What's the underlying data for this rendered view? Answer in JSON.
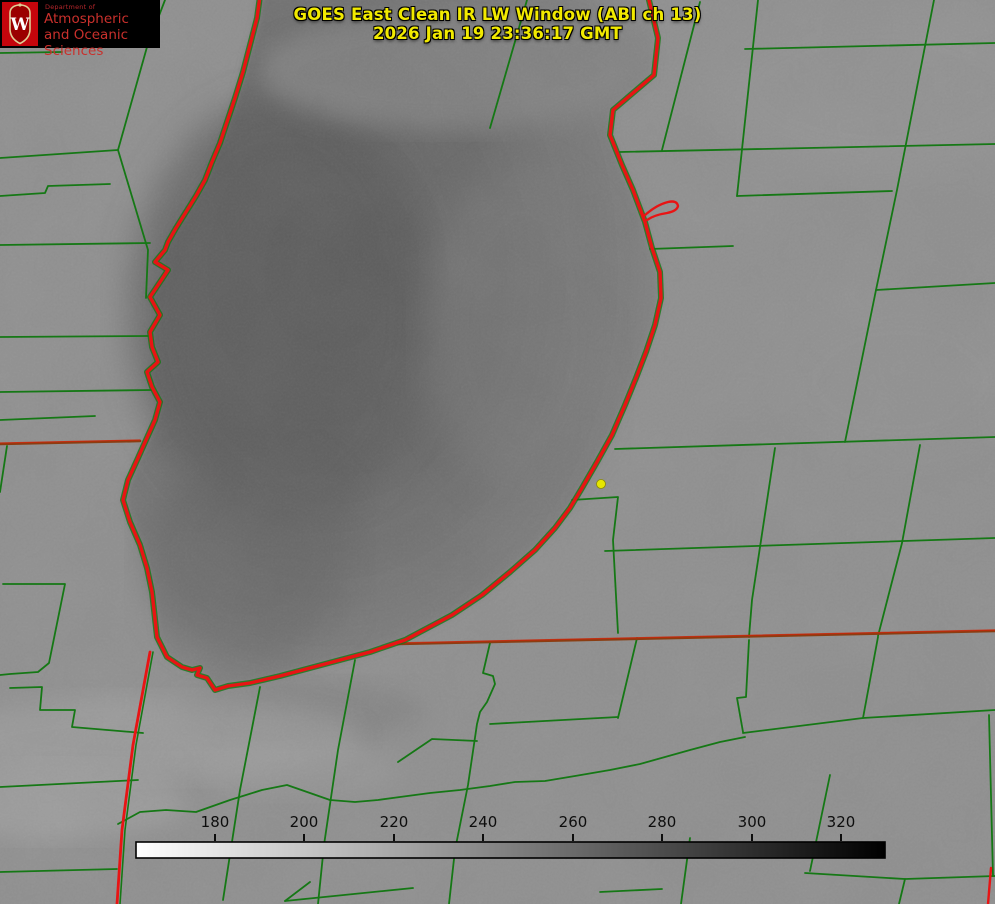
{
  "branding": {
    "department_prefix": "Department of",
    "department_line1": "Atmospheric",
    "department_line2": "and Oceanic Sciences",
    "crest_letter": "W",
    "panel_bg": "#000000",
    "crest_bg": "#c5050c"
  },
  "title": {
    "line1": "GOES East Clean IR LW Window (ABI ch 13)",
    "line2": "2026 Jan 19 23:36:17 GMT",
    "color": "#f2ea00"
  },
  "colorbar": {
    "tick_labels": [
      "180",
      "200",
      "220",
      "240",
      "260",
      "280",
      "300",
      "320"
    ],
    "left_color": "#ffffff",
    "right_color": "#000000"
  },
  "overlay": {
    "county_color": "#157815",
    "shoreline_color": "#e81414",
    "state_color": "#8a3d12",
    "state_red": "#cf2408",
    "marker_color": "#e6e600",
    "marker_x": "601",
    "marker_y": "484"
  }
}
